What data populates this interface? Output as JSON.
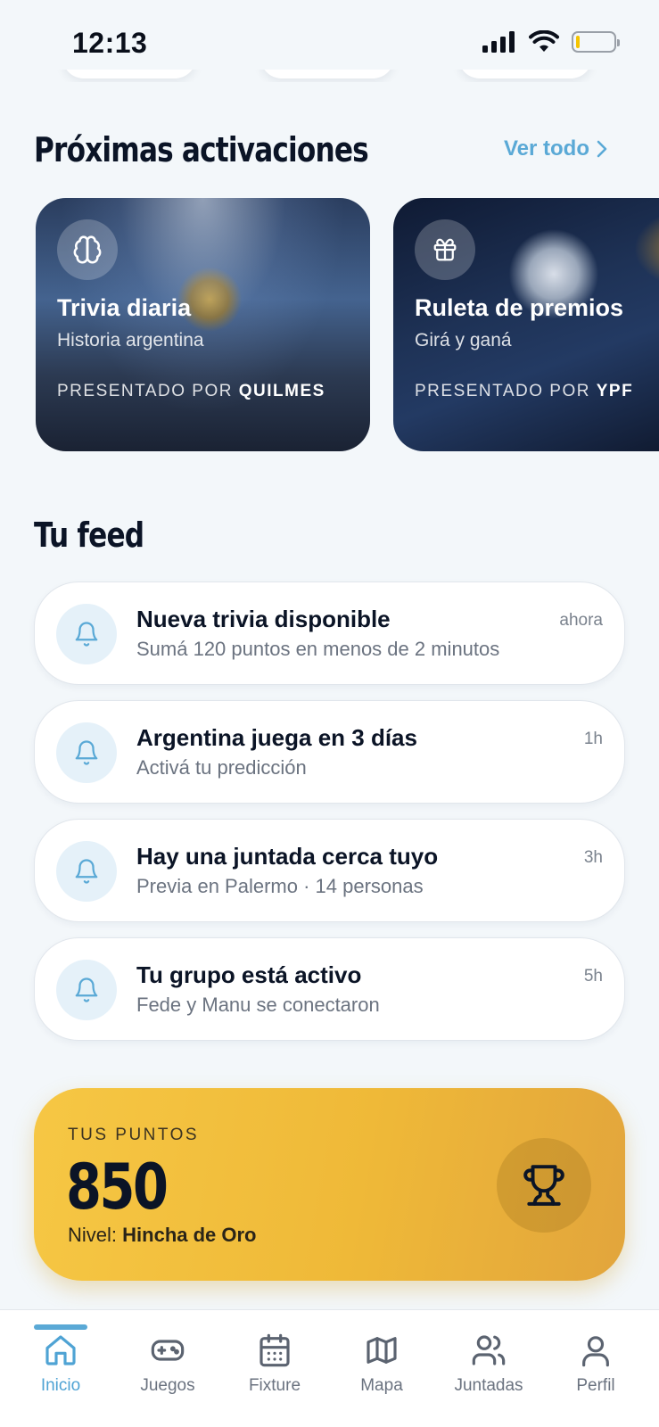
{
  "status_bar": {
    "time": "12:13"
  },
  "activations": {
    "title": "Próximas activaciones",
    "see_all": "Ver todo",
    "cards": [
      {
        "title": "Trivia diaria",
        "subtitle": "Historia argentina",
        "sponsor_prefix": "PRESENTADO POR",
        "sponsor": "QUILMES",
        "icon": "brain-icon"
      },
      {
        "title": "Ruleta de premios",
        "subtitle": "Girá y ganá",
        "sponsor_prefix": "PRESENTADO POR",
        "sponsor": "YPF",
        "icon": "gift-icon"
      }
    ]
  },
  "feed": {
    "title": "Tu feed",
    "items": [
      {
        "title": "Nueva trivia disponible",
        "subtitle": "Sumá 120 puntos en menos de 2 minutos",
        "time": "ahora",
        "icon": "bell-icon"
      },
      {
        "title": "Argentina juega en 3 días",
        "subtitle": "Activá tu predicción",
        "time": "1h",
        "icon": "bell-icon"
      },
      {
        "title": "Hay una juntada cerca tuyo",
        "subtitle": "Previa en Palermo · 14 personas",
        "time": "3h",
        "icon": "bell-icon"
      },
      {
        "title": "Tu grupo está activo",
        "subtitle": "Fede y Manu se conectaron",
        "time": "5h",
        "icon": "bell-icon"
      }
    ]
  },
  "points": {
    "label": "TUS PUNTOS",
    "value": "850",
    "level_prefix": "Nivel:",
    "level": "Hincha de Oro",
    "icon": "trophy-icon"
  },
  "tabs": [
    {
      "label": "Inicio",
      "icon": "home-icon",
      "active": true
    },
    {
      "label": "Juegos",
      "icon": "gamepad-icon",
      "active": false
    },
    {
      "label": "Fixture",
      "icon": "calendar-icon",
      "active": false
    },
    {
      "label": "Mapa",
      "icon": "map-icon",
      "active": false
    },
    {
      "label": "Juntadas",
      "icon": "users-icon",
      "active": false
    },
    {
      "label": "Perfil",
      "icon": "user-icon",
      "active": false
    }
  ],
  "colors": {
    "accent": "#5aa9d6",
    "background": "#f3f7fa",
    "points_gold": "#f2c03e",
    "text_dark": "#0b1426"
  }
}
